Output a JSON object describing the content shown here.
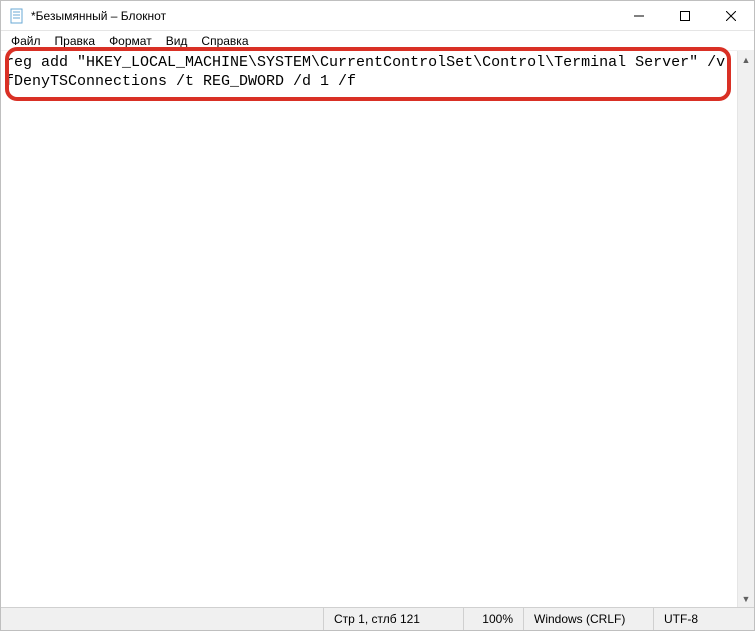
{
  "title": "*Безымянный – Блокнот",
  "menu": {
    "file": "Файл",
    "edit": "Правка",
    "format": "Формат",
    "view": "Вид",
    "help": "Справка"
  },
  "content": "reg add \"HKEY_LOCAL_MACHINE\\SYSTEM\\CurrentControlSet\\Control\\Terminal Server\" /v fDenyTSConnections /t REG_DWORD /d 1 /f",
  "status": {
    "position": "Стр 1, стлб 121",
    "zoom": "100%",
    "eol": "Windows (CRLF)",
    "encoding": "UTF-8"
  }
}
